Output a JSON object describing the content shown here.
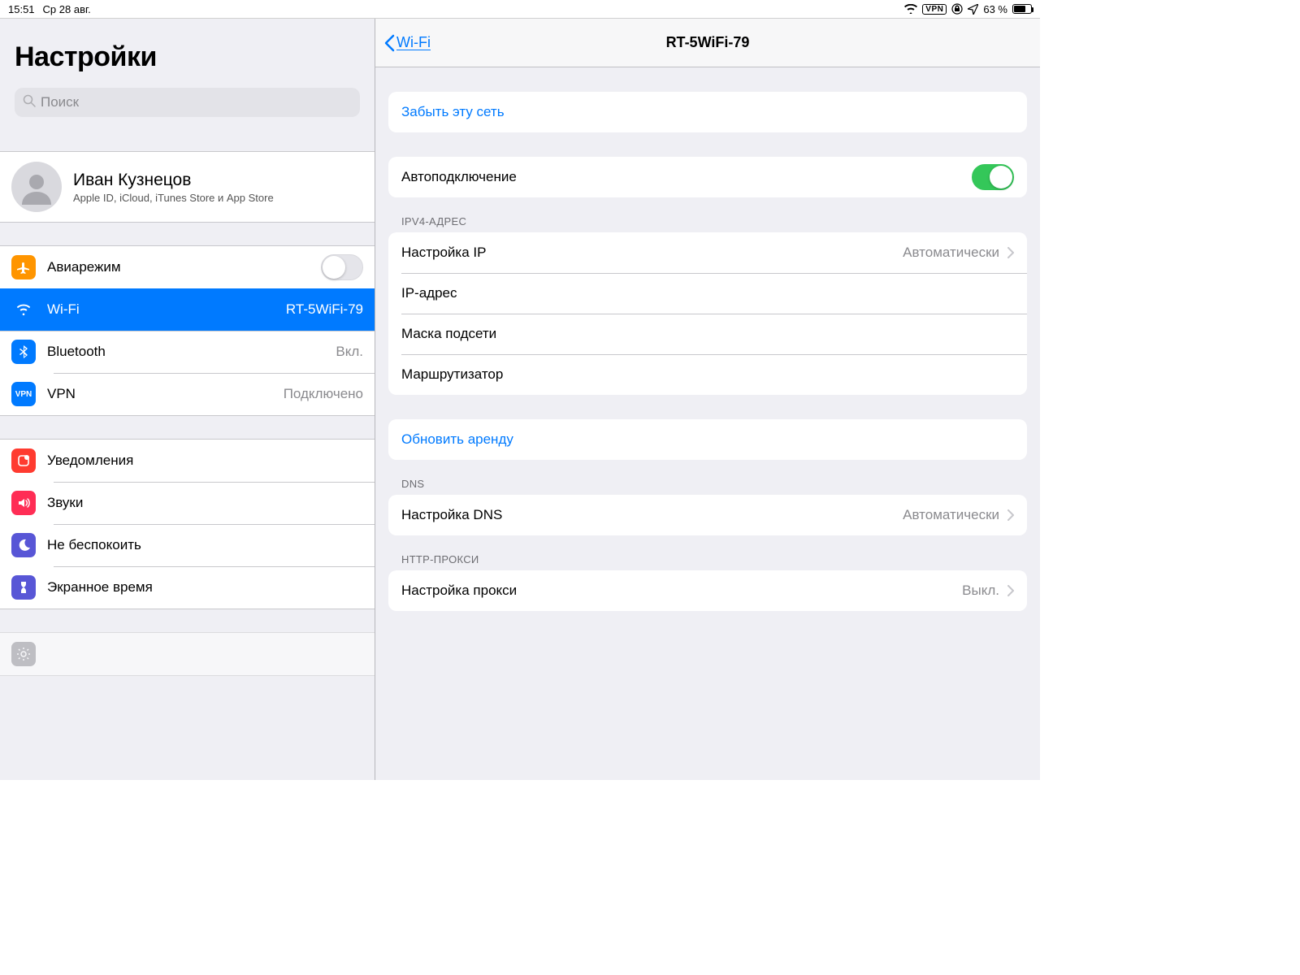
{
  "statusbar": {
    "time": "15:51",
    "date": "Ср 28 авг.",
    "vpn": "VPN",
    "battery_pct": "63 %"
  },
  "sidebar": {
    "title": "Настройки",
    "search_placeholder": "Поиск",
    "account": {
      "name": "Иван Кузнецов",
      "sub": "Apple ID, iCloud, iTunes Store и App Store"
    },
    "group1": {
      "airplane": "Авиарежим",
      "wifi": "Wi-Fi",
      "wifi_value": "RT-5WiFi-79",
      "bluetooth": "Bluetooth",
      "bluetooth_value": "Вкл.",
      "vpn": "VPN",
      "vpn_value": "Подключено"
    },
    "group2": {
      "notifications": "Уведомления",
      "sounds": "Звуки",
      "dnd": "Не беспокоить",
      "screentime": "Экранное время"
    }
  },
  "detail": {
    "back": "Wi-Fi",
    "title": "RT-5WiFi-79",
    "forget": "Забыть эту сеть",
    "autojoin": "Автоподключение",
    "ipv4_header": "IPV4-АДРЕС",
    "configure_ip": "Настройка IP",
    "configure_ip_value": "Автоматически",
    "ip_address": "IP-адрес",
    "subnet": "Маска подсети",
    "router": "Маршрутизатор",
    "renew": "Обновить аренду",
    "dns_header": "DNS",
    "configure_dns": "Настройка DNS",
    "configure_dns_value": "Автоматически",
    "proxy_header": "HTTP-ПРОКСИ",
    "configure_proxy": "Настройка прокси",
    "configure_proxy_value": "Выкл."
  }
}
